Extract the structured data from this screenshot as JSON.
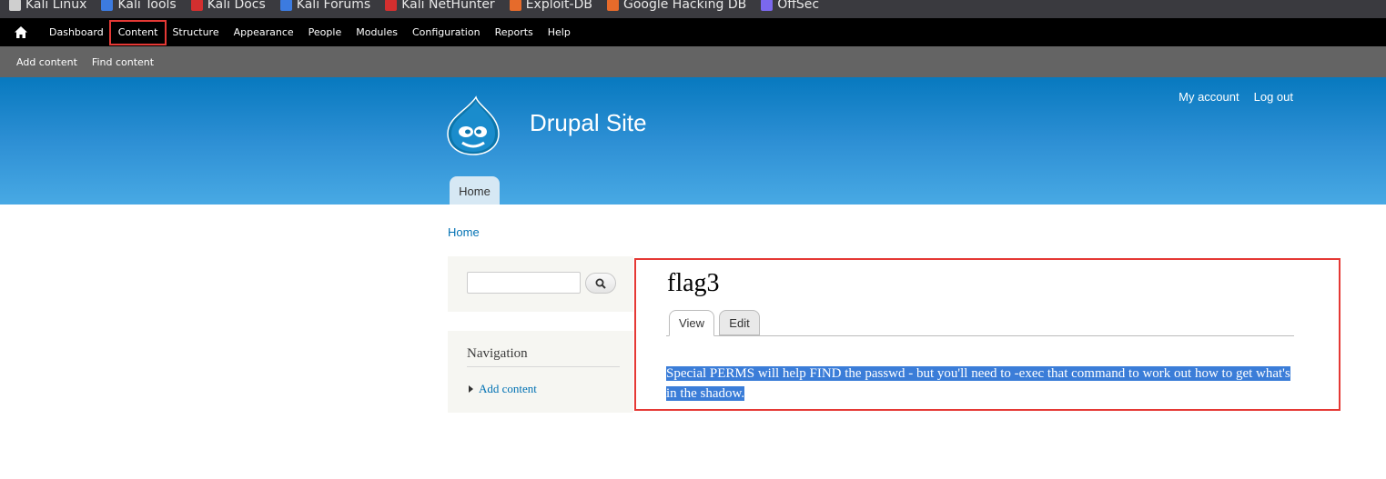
{
  "bookmarks": [
    {
      "label": "Kali Linux",
      "icon": "kali-dragon-icon",
      "color": "#cfcfcf"
    },
    {
      "label": "Kali Tools",
      "icon": "kali-tools-icon",
      "color": "#3c7be0"
    },
    {
      "label": "Kali Docs",
      "icon": "kali-docs-icon",
      "color": "#d32f2f"
    },
    {
      "label": "Kali Forums",
      "icon": "kali-forums-icon",
      "color": "#3c7be0"
    },
    {
      "label": "Kali NetHunter",
      "icon": "nethunter-icon",
      "color": "#d32f2f"
    },
    {
      "label": "Exploit-DB",
      "icon": "exploit-db-icon",
      "color": "#e66b2b"
    },
    {
      "label": "Google Hacking DB",
      "icon": "ghdb-icon",
      "color": "#e66b2b"
    },
    {
      "label": "OffSec",
      "icon": "offsec-icon",
      "color": "#7b68ee"
    }
  ],
  "toolbar": {
    "items": [
      "Dashboard",
      "Content",
      "Structure",
      "Appearance",
      "People",
      "Modules",
      "Configuration",
      "Reports",
      "Help"
    ],
    "highlighted": "Content"
  },
  "shortcuts": [
    "Add content",
    "Find content"
  ],
  "header": {
    "site_name": "Drupal Site",
    "secondary_menu": [
      "My account",
      "Log out"
    ],
    "main_tab": "Home"
  },
  "breadcrumb": "Home",
  "sidebar": {
    "navigation_title": "Navigation",
    "nav_items": [
      "Add content"
    ]
  },
  "node": {
    "title": "flag3",
    "tabs": [
      "View",
      "Edit"
    ],
    "active_tab": "View",
    "body": "Special PERMS will help FIND the passwd - but you'll need to -exec that command to work out how to get what's in the shadow."
  },
  "colors": {
    "accent_highlight": "#e53935",
    "selection": "#3b7dd8",
    "link": "#0071b3"
  }
}
